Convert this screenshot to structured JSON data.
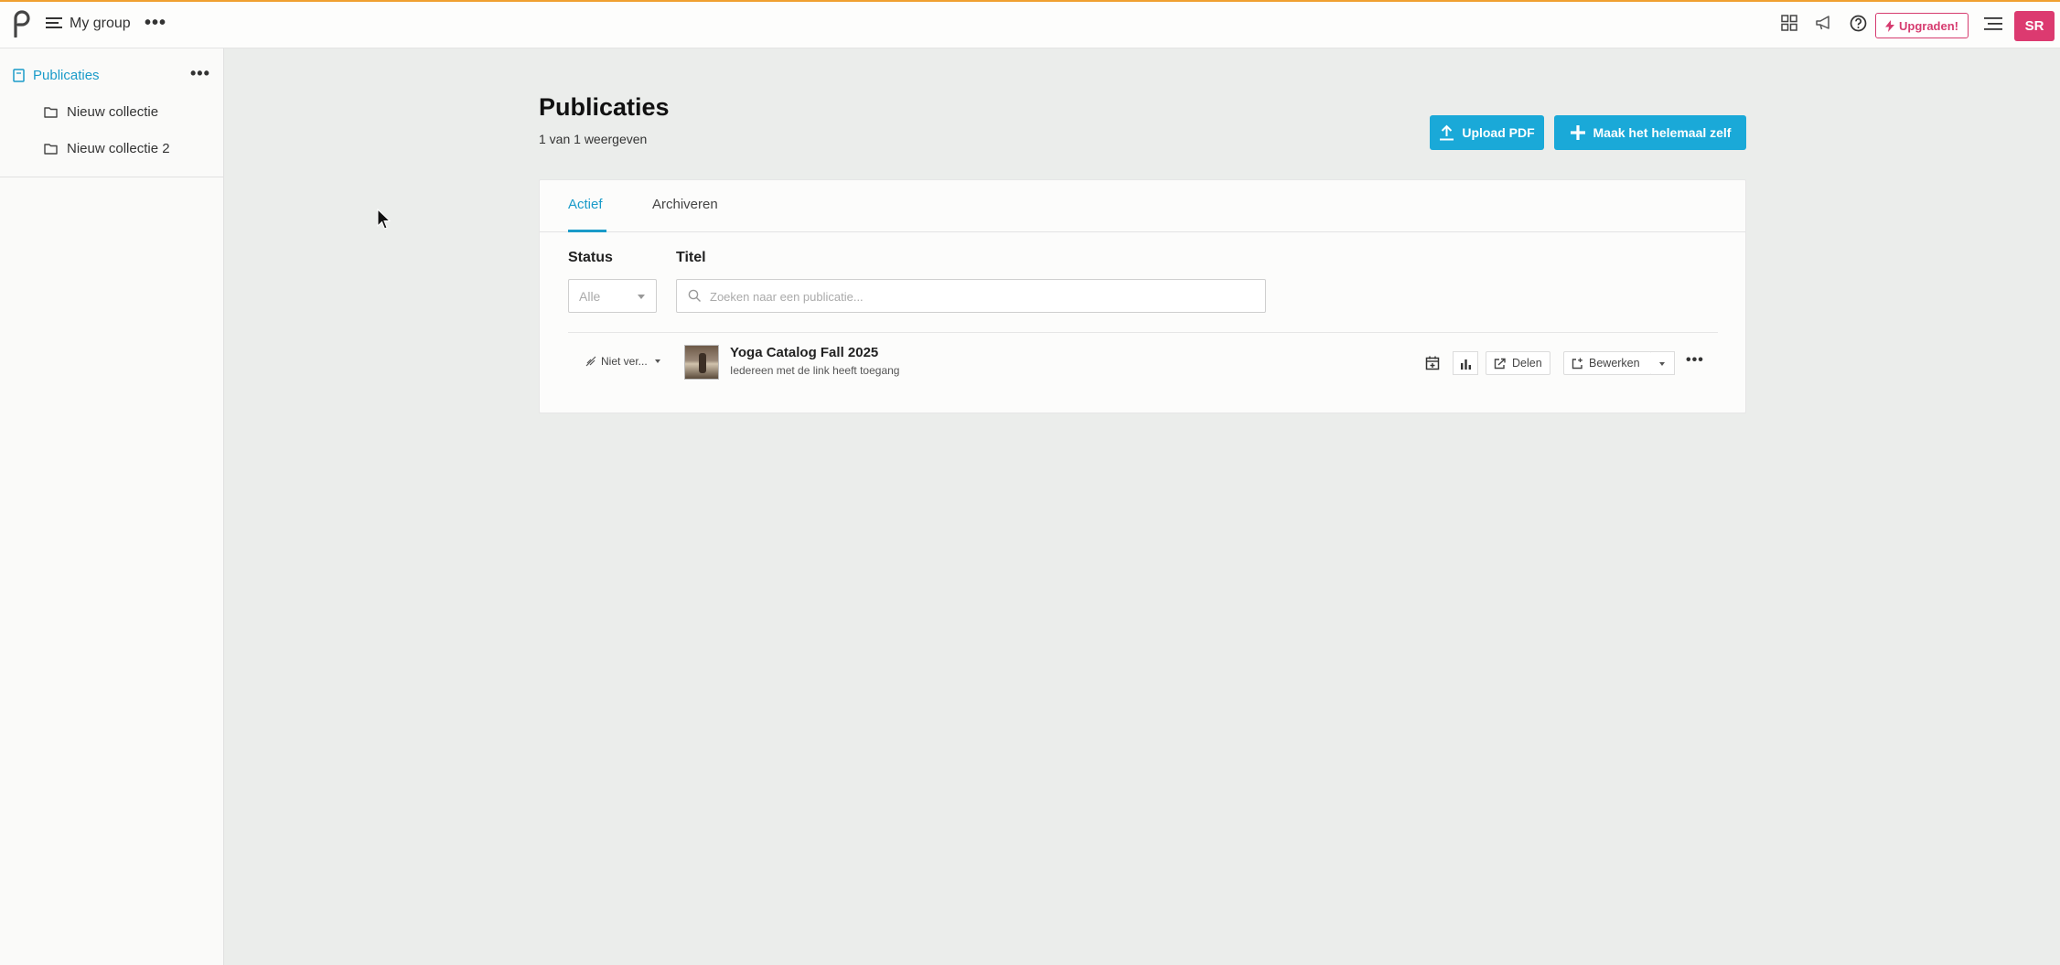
{
  "topbar": {
    "group_name": "My group",
    "more_label": "•••",
    "upgrade_label": "Upgraden!",
    "avatar_initials": "SR",
    "accent_color": "#f0a030",
    "brand_pink": "#dc3a70",
    "icons": [
      "logo-icon",
      "hamburger-icon",
      "apps-grid-icon",
      "megaphone-icon",
      "help-icon",
      "lightning-icon",
      "list-menu-icon"
    ]
  },
  "sidebar": {
    "root_label": "Publicaties",
    "more_label": "•••",
    "items": [
      {
        "label": "Nieuw collectie",
        "icon": "folder-icon"
      },
      {
        "label": "Nieuw collectie 2",
        "icon": "folder-icon"
      }
    ]
  },
  "main": {
    "title": "Publicaties",
    "count_text": "1 van 1 weergeven",
    "upload_label": "Upload PDF",
    "create_label": "Maak het helemaal zelf",
    "accent_color": "#1aa9d8",
    "tabs": [
      {
        "label": "Actief",
        "active": true
      },
      {
        "label": "Archiveren",
        "active": false
      }
    ],
    "filters": {
      "status_label": "Status",
      "status_value": "Alle",
      "title_label": "Titel",
      "search_placeholder": "Zoeken naar een publicatie..."
    },
    "publications": [
      {
        "status": "Niet ver...",
        "title": "Yoga Catalog Fall 2025",
        "subtitle": "Iedereen met de link heeft toegang",
        "share_label": "Delen",
        "edit_label": "Bewerken",
        "more_label": "•••"
      }
    ]
  }
}
